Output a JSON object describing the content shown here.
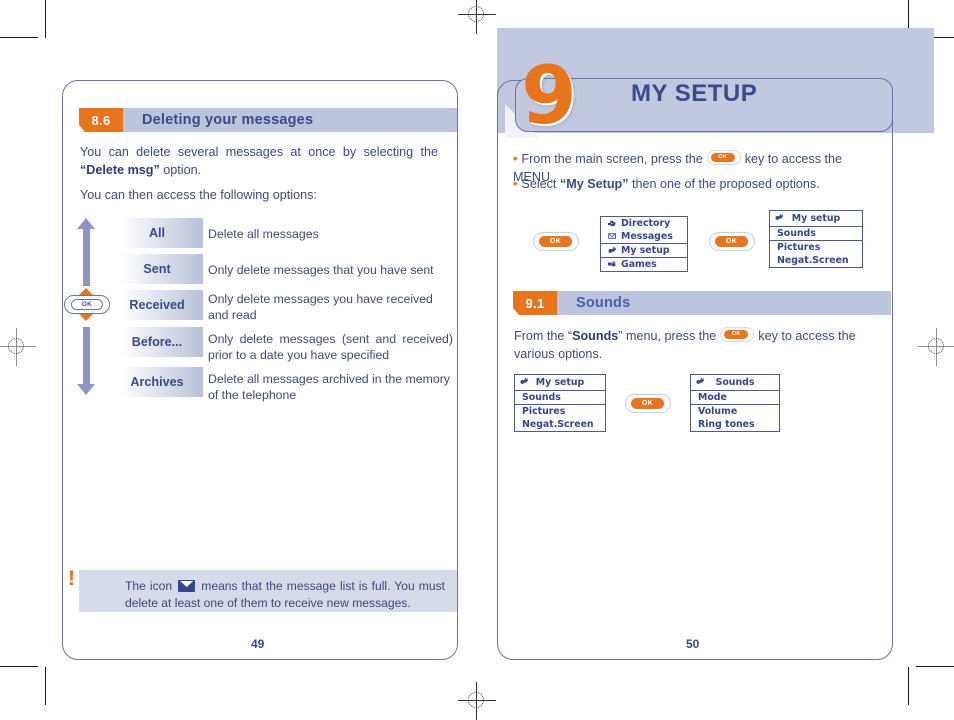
{
  "document": {
    "left_page": {
      "page_number": "49",
      "section": {
        "number": "8.6",
        "title": "Deleting your messages"
      },
      "intro_paragraph_1_prefix": "You can delete several messages at once by selecting the ",
      "intro_paragraph_1_bold": "“Delete msg”",
      "intro_paragraph_1_suffix": " option.",
      "intro_paragraph_2": "You can then access the following options:",
      "options": [
        {
          "label": "All",
          "description": "Delete all messages"
        },
        {
          "label": "Sent",
          "description": "Only delete messages that you have sent"
        },
        {
          "label": "Received",
          "description": "Only delete messages you have received and read"
        },
        {
          "label": "Before...",
          "description": "Only delete messages (sent and received) prior to a date you have specified"
        },
        {
          "label": "Archives",
          "description": "Delete all messages archived in the memory of  the telephone"
        }
      ],
      "nav_key_label": "OK",
      "note": {
        "marker": "!",
        "text_before_icon": "The icon ",
        "icon_name": "envelope-icon",
        "text_after_icon": " means that the message list is full. You must delete at least one of them to receive new messages."
      }
    },
    "right_page": {
      "page_number": "50",
      "chapter": {
        "number": "9",
        "title": "MY SETUP"
      },
      "bullets": [
        {
          "before_key": "From the main screen, press the",
          "key_label": "OK",
          "after_key": "key to access the MENU."
        },
        {
          "before_bold": "Select ",
          "bold": "“My Setup”",
          "after_bold": " then one of the proposed options."
        }
      ],
      "flow_1": {
        "key_label": "OK",
        "screen_1": {
          "rows": [
            {
              "label": "Directory",
              "icon": "directory-icon",
              "selected": false
            },
            {
              "label": "Messages",
              "icon": "messages-icon",
              "selected": false
            },
            {
              "label": "My setup",
              "icon": "my-setup-icon",
              "selected": true
            },
            {
              "label": "Games",
              "icon": "games-icon",
              "selected": false
            }
          ]
        },
        "key_label_2": "OK",
        "screen_2": {
          "title": "My setup",
          "title_icon": "my-setup-icon",
          "rows": [
            {
              "label": "Sounds",
              "selected": true
            },
            {
              "label": "Pictures",
              "selected": false
            },
            {
              "label": "Negat.Screen",
              "selected": false
            }
          ]
        }
      },
      "section": {
        "number": "9.1",
        "title": "Sounds"
      },
      "section_text": {
        "before_bold": "From the “",
        "bold": "Sounds",
        "mid": "” menu, press the",
        "key_label": "OK",
        "after_key": "key to access the various options."
      },
      "flow_2": {
        "screen_1": {
          "title": "My setup",
          "title_icon": "my-setup-icon",
          "rows": [
            {
              "label": "Sounds",
              "selected": true
            },
            {
              "label": "Pictures",
              "selected": false
            },
            {
              "label": "Negat.Screen",
              "selected": false
            }
          ]
        },
        "key_label": "OK",
        "screen_2": {
          "title": "Sounds",
          "title_icon": "my-setup-icon",
          "rows": [
            {
              "label": "Mode",
              "selected": true
            },
            {
              "label": "Volume",
              "selected": false
            },
            {
              "label": "Ring tones",
              "selected": false
            }
          ]
        }
      }
    },
    "colors": {
      "accent_orange": "#e8741c",
      "heading_blue": "#3c4a8a",
      "bar_blue": "#bdc4dd",
      "panel_blue": "#c2c8e0",
      "text_blue": "#3d4a7e",
      "frame_blue": "#6a74a8"
    }
  }
}
